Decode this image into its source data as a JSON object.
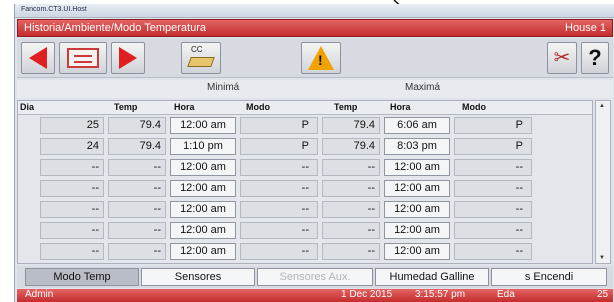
{
  "window_title": "Fancom.CT3.UI.Host",
  "header": {
    "title": "Historia/Ambiente/Modo Temperatura",
    "house": "House 1"
  },
  "toolbar": {
    "cc_label": "CC",
    "warning_glyph": "!",
    "help_glyph": "?",
    "tools_glyph": "✂",
    "icons": [
      "arrow-left-icon",
      "document-icon",
      "arrow-right-icon",
      "cc-card-icon",
      "warning-icon",
      "tools-icon",
      "help-icon"
    ],
    "colors": {
      "arrow": "#e02020",
      "warning": "#f2a200",
      "header_bar": "#d03a3a"
    }
  },
  "groups": {
    "min": "Minimá",
    "max": "Maximá"
  },
  "columns": [
    "Dia",
    "Temp",
    "Hora",
    "Modo",
    "Temp",
    "Hora",
    "Modo"
  ],
  "rows": [
    {
      "dia": "25",
      "min_temp": "79.4",
      "min_hora": "12:00 am",
      "min_modo": "P",
      "max_temp": "79.4",
      "max_hora": "6:06 am",
      "max_modo": "P"
    },
    {
      "dia": "24",
      "min_temp": "79.4",
      "min_hora": "1:10 pm",
      "min_modo": "P",
      "max_temp": "79.4",
      "max_hora": "8:03 pm",
      "max_modo": "P"
    },
    {
      "dia": "--",
      "min_temp": "--",
      "min_hora": "12:00 am",
      "min_modo": "--",
      "max_temp": "--",
      "max_hora": "12:00 am",
      "max_modo": "--"
    },
    {
      "dia": "--",
      "min_temp": "--",
      "min_hora": "12:00 am",
      "min_modo": "--",
      "max_temp": "--",
      "max_hora": "12:00 am",
      "max_modo": "--"
    },
    {
      "dia": "--",
      "min_temp": "--",
      "min_hora": "12:00 am",
      "min_modo": "--",
      "max_temp": "--",
      "max_hora": "12:00 am",
      "max_modo": "--"
    },
    {
      "dia": "--",
      "min_temp": "--",
      "min_hora": "12:00 am",
      "min_modo": "--",
      "max_temp": "--",
      "max_hora": "12:00 am",
      "max_modo": "--"
    },
    {
      "dia": "--",
      "min_temp": "--",
      "min_hora": "12:00 am",
      "min_modo": "--",
      "max_temp": "--",
      "max_hora": "12:00 am",
      "max_modo": "--"
    }
  ],
  "tabs": [
    {
      "label": "Modo Temp",
      "state": "active"
    },
    {
      "label": "Sensores",
      "state": "normal"
    },
    {
      "label": "Sensores Aux.",
      "state": "disabled"
    },
    {
      "label": "Humedad Galline",
      "state": "normal"
    },
    {
      "label": "s Encendi",
      "state": "normal"
    }
  ],
  "status": {
    "user": "Admin",
    "date": "1 Dec 2015",
    "time": "3:15:57 pm",
    "age_label": "Eda",
    "age_value": "25"
  }
}
